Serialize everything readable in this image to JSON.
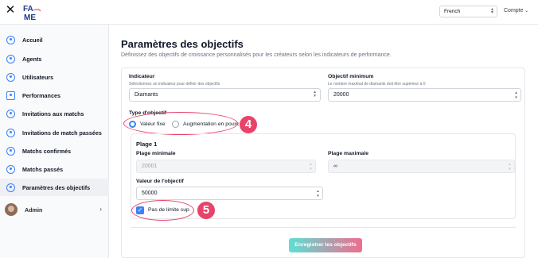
{
  "topbar": {
    "close_glyph": "✕",
    "language": "French",
    "account_label": "Compte"
  },
  "sidebar": {
    "items": [
      {
        "label": "Accueil",
        "icon": "dashboard-icon"
      },
      {
        "label": "Agents",
        "icon": "user-icon"
      },
      {
        "label": "Utilisateurs",
        "icon": "user-icon"
      },
      {
        "label": "Performances",
        "icon": "chart-icon"
      },
      {
        "label": "Invitations aux matchs",
        "icon": "invite-icon"
      },
      {
        "label": "Invitations de match passées",
        "icon": "invite-icon"
      },
      {
        "label": "Matchs confirmés",
        "icon": "match-icon"
      },
      {
        "label": "Matchs passés",
        "icon": "match-icon"
      },
      {
        "label": "Paramètres des objectifs",
        "icon": "target-icon",
        "active": true
      }
    ],
    "admin_label": "Admin"
  },
  "main": {
    "title": "Paramètres des objectifs",
    "subtitle": "Définissez des objectifs de croissance personnalisés pour les créateurs selon les indicateurs de performance."
  },
  "form": {
    "indicator_label": "Indicateur",
    "indicator_help": "Sélectionnez un indicateur pour définir des objectifs",
    "indicator_value": "Diamants",
    "min_goal_label": "Objectif minimum",
    "min_goal_help": "Le nombre maximal de diamants doit être supérieur à 0",
    "min_goal_value": "20000",
    "goal_type_label": "Type d'objectif",
    "goal_type_options": [
      "Valeur fixe",
      "Augmentation en pourc"
    ],
    "goal_type_selected": "Valeur fixe",
    "level": {
      "title": "Plage 1",
      "min_range_label": "Plage minimale",
      "min_range_value": "20001",
      "max_range_label": "Plage maximale",
      "max_range_value": "∞",
      "goal_value_label": "Valeur de l'objectif",
      "goal_value": "50000",
      "no_upper_limit_label": "Pas de limite sup",
      "no_upper_limit_checked": true
    },
    "submit_label": "Enregistrer les objectifs"
  },
  "annotations": {
    "badge_4": "4",
    "badge_5": "5"
  },
  "colors": {
    "accent": "#3b82f6",
    "highlight": "#e8436a"
  }
}
